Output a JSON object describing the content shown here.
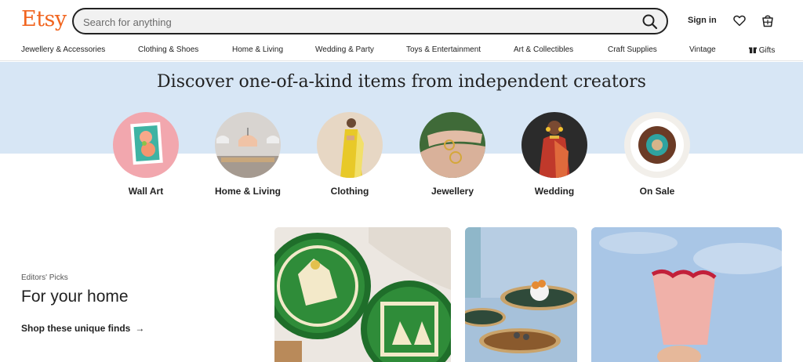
{
  "header": {
    "logo": "Etsy",
    "search_placeholder": "Search for anything",
    "signin": "Sign in"
  },
  "nav": {
    "items": [
      "Jewellery & Accessories",
      "Clothing & Shoes",
      "Home & Living",
      "Wedding & Party",
      "Toys & Entertainment",
      "Art & Collectibles",
      "Craft Supplies",
      "Vintage"
    ],
    "gifts": "Gifts"
  },
  "hero": {
    "title": "Discover one-of-a-kind items from independent creators"
  },
  "categories": [
    {
      "label": "Wall Art"
    },
    {
      "label": "Home & Living"
    },
    {
      "label": "Clothing"
    },
    {
      "label": "Jewellery"
    },
    {
      "label": "Wedding"
    },
    {
      "label": "On Sale"
    }
  ],
  "editors": {
    "eyebrow": "Editors' Picks",
    "title": "For your home",
    "link": "Shop these unique finds",
    "arrow": "→"
  },
  "colors": {
    "brand": "#f1641e",
    "hero_band": "#d7e6f5"
  }
}
